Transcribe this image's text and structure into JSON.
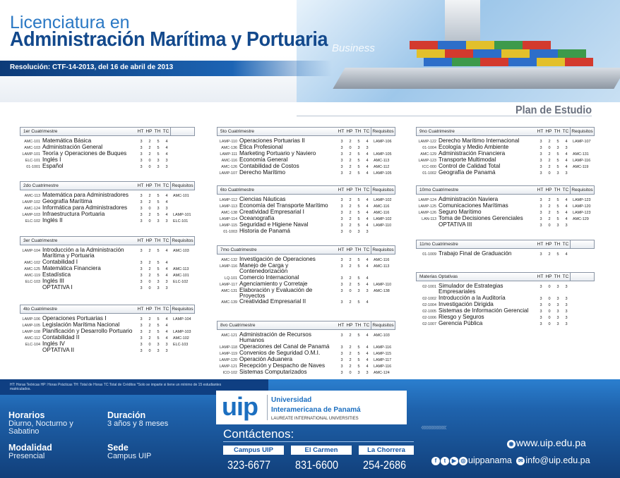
{
  "header": {
    "title1": "Licenciatura en",
    "title2": "Administración Marítima y Portuaria",
    "resolution": "Resolución:  CTF-14-2013, del 16 de abril de 2013",
    "watermark": "Business",
    "plan": "Plan de Estudio"
  },
  "columns": {
    "ht": "HT",
    "hp": "HP",
    "th": "TH",
    "tc": "TC",
    "req": "Requisitos"
  },
  "blocks": [
    {
      "title": "1er Cuatrimestre",
      "req": false,
      "rows": [
        [
          "AMC-101",
          "Matemática Básica",
          "3",
          "2",
          "5",
          "4",
          ""
        ],
        [
          "AMC-103",
          "Administración General",
          "3",
          "2",
          "5",
          "4",
          ""
        ],
        [
          "LAMP-101",
          "Teoría y Operaciones de Buques",
          "3",
          "2",
          "5",
          "4",
          ""
        ],
        [
          "ELC-101",
          "Inglés I",
          "3",
          "0",
          "3",
          "3",
          ""
        ],
        [
          "01-1001",
          "Español",
          "3",
          "0",
          "3",
          "3",
          ""
        ]
      ]
    },
    {
      "title": "2do Cuatrimestre",
      "req": true,
      "rows": [
        [
          "AMC-113",
          "Matemática para Administradores",
          "3",
          "2",
          "5",
          "4",
          "AMC-101"
        ],
        [
          "LAMP-102",
          "Geografía Marítima",
          "3",
          "2",
          "5",
          "4",
          ""
        ],
        [
          "AMC-124",
          "Informática para Administradores",
          "3",
          "0",
          "3",
          "3",
          ""
        ],
        [
          "LAMP-103",
          "Infraestructura Portuaria",
          "3",
          "2",
          "5",
          "4",
          "LAMP-101"
        ],
        [
          "ELC-102",
          "Inglés II",
          "3",
          "0",
          "3",
          "3",
          "ELC-101"
        ]
      ]
    },
    {
      "title": "3er Cuatrimestre",
      "req": true,
      "rows": [
        [
          "LAMP-104",
          "Introducción a la Administración Marítima y Portuaria",
          "3",
          "2",
          "5",
          "4",
          "AMC-103"
        ],
        [
          "AMC-102",
          "Contabilidad I",
          "3",
          "2",
          "5",
          "4",
          ""
        ],
        [
          "AMC-125",
          "Matemática Financiera",
          "3",
          "2",
          "5",
          "4",
          "AMC-113"
        ],
        [
          "AMC-119",
          "Estadística",
          "3",
          "2",
          "5",
          "4",
          "AMC-101"
        ],
        [
          "ELC-103",
          "Inglés III",
          "3",
          "0",
          "3",
          "3",
          "ELC-102"
        ],
        [
          "",
          "OPTATIVA I",
          "3",
          "0",
          "3",
          "3",
          ""
        ]
      ]
    },
    {
      "title": "4to Cuatrimestre",
      "req": true,
      "rows": [
        [
          "LAMP-106",
          "Operaciones Portuarias I",
          "3",
          "2",
          "5",
          "4",
          "LAMP-104"
        ],
        [
          "LAMP-105",
          "Legislación Marítima Nacional",
          "3",
          "2",
          "5",
          "4",
          ""
        ],
        [
          "LAMP-108",
          "Planificación y Desarrollo Portuario",
          "3",
          "2",
          "5",
          "4",
          "LAMP-103"
        ],
        [
          "AMC-112",
          "Contabilidad II",
          "3",
          "2",
          "5",
          "4",
          "AMC-102"
        ],
        [
          "ELC-104",
          "Inglés IV",
          "3",
          "0",
          "3",
          "3",
          "ELC-103"
        ],
        [
          "",
          "OPTATIVA II",
          "3",
          "0",
          "3",
          "3",
          ""
        ]
      ]
    },
    {
      "title": "5to Cuatrimestre",
      "req": true,
      "rows": [
        [
          "LAMP-110",
          "Operaciones Portuarias II",
          "3",
          "2",
          "5",
          "4",
          "LAMP-106"
        ],
        [
          "AMC-136",
          "Ética Profesional",
          "3",
          "0",
          "3",
          "3",
          ""
        ],
        [
          "LAMP-111",
          "Marketing Portuario y Naviero",
          "3",
          "2",
          "5",
          "4",
          "LAMP-105"
        ],
        [
          "AMC-116",
          "Economía General",
          "3",
          "2",
          "5",
          "4",
          "AMC-113"
        ],
        [
          "AMC-126",
          "Contabilidad de Costos",
          "3",
          "2",
          "5",
          "4",
          "AMC-112"
        ],
        [
          "LAMP-107",
          "Derecho Marítimo",
          "3",
          "2",
          "5",
          "4",
          "LAMP-105"
        ]
      ]
    },
    {
      "title": "6to Cuatrimestre",
      "req": true,
      "rows": [
        [
          "LAMP-112",
          "Ciencias Náuticas",
          "3",
          "2",
          "5",
          "4",
          "LAMP-102"
        ],
        [
          "LAMP-113",
          "Economía del Transporte Marítimo",
          "3",
          "2",
          "5",
          "4",
          "AMC-116"
        ],
        [
          "AMC-138",
          "Creatividad Empresarial I",
          "3",
          "2",
          "5",
          "4",
          "AMC-116"
        ],
        [
          "LAMP-114",
          "Oceanografía",
          "3",
          "2",
          "5",
          "4",
          "LAMP-102"
        ],
        [
          "LAMP-115",
          "Seguridad e Higiene Naval",
          "3",
          "2",
          "5",
          "4",
          "LAMP-110"
        ],
        [
          "01-1003",
          "Historia de Panamá",
          "3",
          "0",
          "3",
          "3",
          ""
        ]
      ]
    },
    {
      "title": "7mo Cuatrimestre",
      "req": true,
      "rows": [
        [
          "AMC-132",
          "Investigación de Operaciones",
          "3",
          "2",
          "5",
          "4",
          "AMC-116"
        ],
        [
          "LAMP-116",
          "Manejo de Carga y Contenedorización",
          "3",
          "2",
          "5",
          "4",
          "AMC-113"
        ],
        [
          "LQ-101",
          "Comercio Internacional",
          "3",
          "2",
          "5",
          "4",
          ""
        ],
        [
          "LAMP-117",
          "Agenciamiento y Corretaje",
          "3",
          "2",
          "5",
          "4",
          "LAMP-110"
        ],
        [
          "AMC-131",
          "Elaboración y Evaluación de Proyectos",
          "3",
          "0",
          "3",
          "3",
          "AMC-138"
        ],
        [
          "AMC-139",
          "Creatividad Empresarial II",
          "3",
          "2",
          "5",
          "4",
          ""
        ]
      ]
    },
    {
      "title": "8vo Cuatrimestre",
      "req": true,
      "rows": [
        [
          "AMC-121",
          "Administración de Recursos Humanos",
          "3",
          "2",
          "5",
          "4",
          "AMC-103"
        ],
        [
          "LAMP-118",
          "Operaciones del Canal de Panamá",
          "3",
          "2",
          "5",
          "4",
          "LAMP-116"
        ],
        [
          "LAMP-119",
          "Convenios de Seguridad O.M.I.",
          "3",
          "2",
          "5",
          "4",
          "LAMP-115"
        ],
        [
          "LAMP-120",
          "Operación Aduanera",
          "3",
          "2",
          "5",
          "4",
          "LAMP-117"
        ],
        [
          "LAMP-121",
          "Recepción y Despacho de Naves",
          "3",
          "2",
          "5",
          "4",
          "LAMP-116"
        ],
        [
          "ICO-102",
          "Sistemas Computarizados",
          "3",
          "0",
          "3",
          "3",
          "AMC-124"
        ]
      ]
    },
    {
      "title": "9no Cuatrimestre",
      "req": true,
      "rows": [
        [
          "LAMP-122",
          "Derecho Marítimo Internacional",
          "3",
          "2",
          "5",
          "4",
          "LAMP-107"
        ],
        [
          "01-1004",
          "Ecología y Medio Ambiente",
          "3",
          "0",
          "3",
          "3",
          ""
        ],
        [
          "AMC-129",
          "Administración Financiera",
          "3",
          "2",
          "5",
          "4",
          "AMC-131"
        ],
        [
          "LAMP-123",
          "Transporte Multimodal",
          "3",
          "2",
          "5",
          "4",
          "LAMP-116"
        ],
        [
          "ICC-000",
          "Control de Calidad Total",
          "3",
          "2",
          "5",
          "4",
          "AMC-119"
        ],
        [
          "01-1002",
          "Geografía de Panamá",
          "3",
          "0",
          "3",
          "3",
          ""
        ]
      ]
    },
    {
      "title": "10mo Cuatrimestre",
      "req": true,
      "rows": [
        [
          "LAMP-124",
          "Administración Naviera",
          "3",
          "2",
          "5",
          "4",
          "LAMP-123"
        ],
        [
          "LAMP-125",
          "Comunicaciones Marítimas",
          "3",
          "2",
          "5",
          "4",
          "LAMP-120"
        ],
        [
          "LAMP-126",
          "Seguro Marítimo",
          "3",
          "2",
          "5",
          "4",
          "LAMP-123"
        ],
        [
          "LAN-113",
          "Toma de Decisiones Gerenciales",
          "3",
          "2",
          "5",
          "4",
          "AMC-129"
        ],
        [
          "",
          "OPTATIVA III",
          "3",
          "0",
          "3",
          "3",
          ""
        ]
      ]
    },
    {
      "title": "11mo Cuatrimestre",
      "req": false,
      "rows": [
        [
          "01-1009",
          "Trabajo Final de Graduación",
          "3",
          "2",
          "5",
          "4",
          ""
        ]
      ]
    },
    {
      "title": "Materias Optativas",
      "req": false,
      "rows": [
        [
          "02-1001",
          "Simulador de Estrategias Empresariales",
          "3",
          "0",
          "3",
          "3",
          ""
        ],
        [
          "02-1002",
          "Introducción a la Auditoría",
          "3",
          "0",
          "3",
          "3",
          ""
        ],
        [
          "02-1004",
          "Investigación Dirigida",
          "3",
          "0",
          "3",
          "3",
          ""
        ],
        [
          "02-1005",
          "Sistemas de Información Gerencial",
          "3",
          "0",
          "3",
          "3",
          ""
        ],
        [
          "02-1006",
          "Riesgo y Seguros",
          "3",
          "0",
          "3",
          "3",
          ""
        ],
        [
          "02-1007",
          "Gerencia Pública",
          "3",
          "0",
          "3",
          "3",
          ""
        ]
      ]
    }
  ],
  "footer": {
    "note": "HT: Horas Teóricas   HP: Horas Prácticas   TH: Total de Horas   TC:Total de Créditos *Solo se imparte si tiene un mínimo de 15 estudiantes matriculados.",
    "horarios_label": "Horarios",
    "horarios_value": "Diurno, Nocturno y Sabatino",
    "duracion_label": "Duración",
    "duracion_value": "3 años y 8 meses",
    "modalidad_label": "Modalidad",
    "modalidad_value": "Presencial",
    "sede_label": "Sede",
    "sede_value": "Campus UIP",
    "logo_text": "uip",
    "uni1": "Universidad",
    "uni2": "Interamericana de Panamá",
    "uni3": "LAUREATE INTERNATIONAL UNIVERSITIES",
    "contact_title": "Contáctenos:",
    "campuses": [
      {
        "name": "Campus UIP",
        "phone": "323-6677"
      },
      {
        "name": "El Carmen",
        "phone": "831-6600"
      },
      {
        "name": "La Chorrera",
        "phone": "254-2686"
      }
    ],
    "web": "www.uip.edu.pa",
    "social": "uippanama",
    "email": "info@uip.edu.pa"
  }
}
